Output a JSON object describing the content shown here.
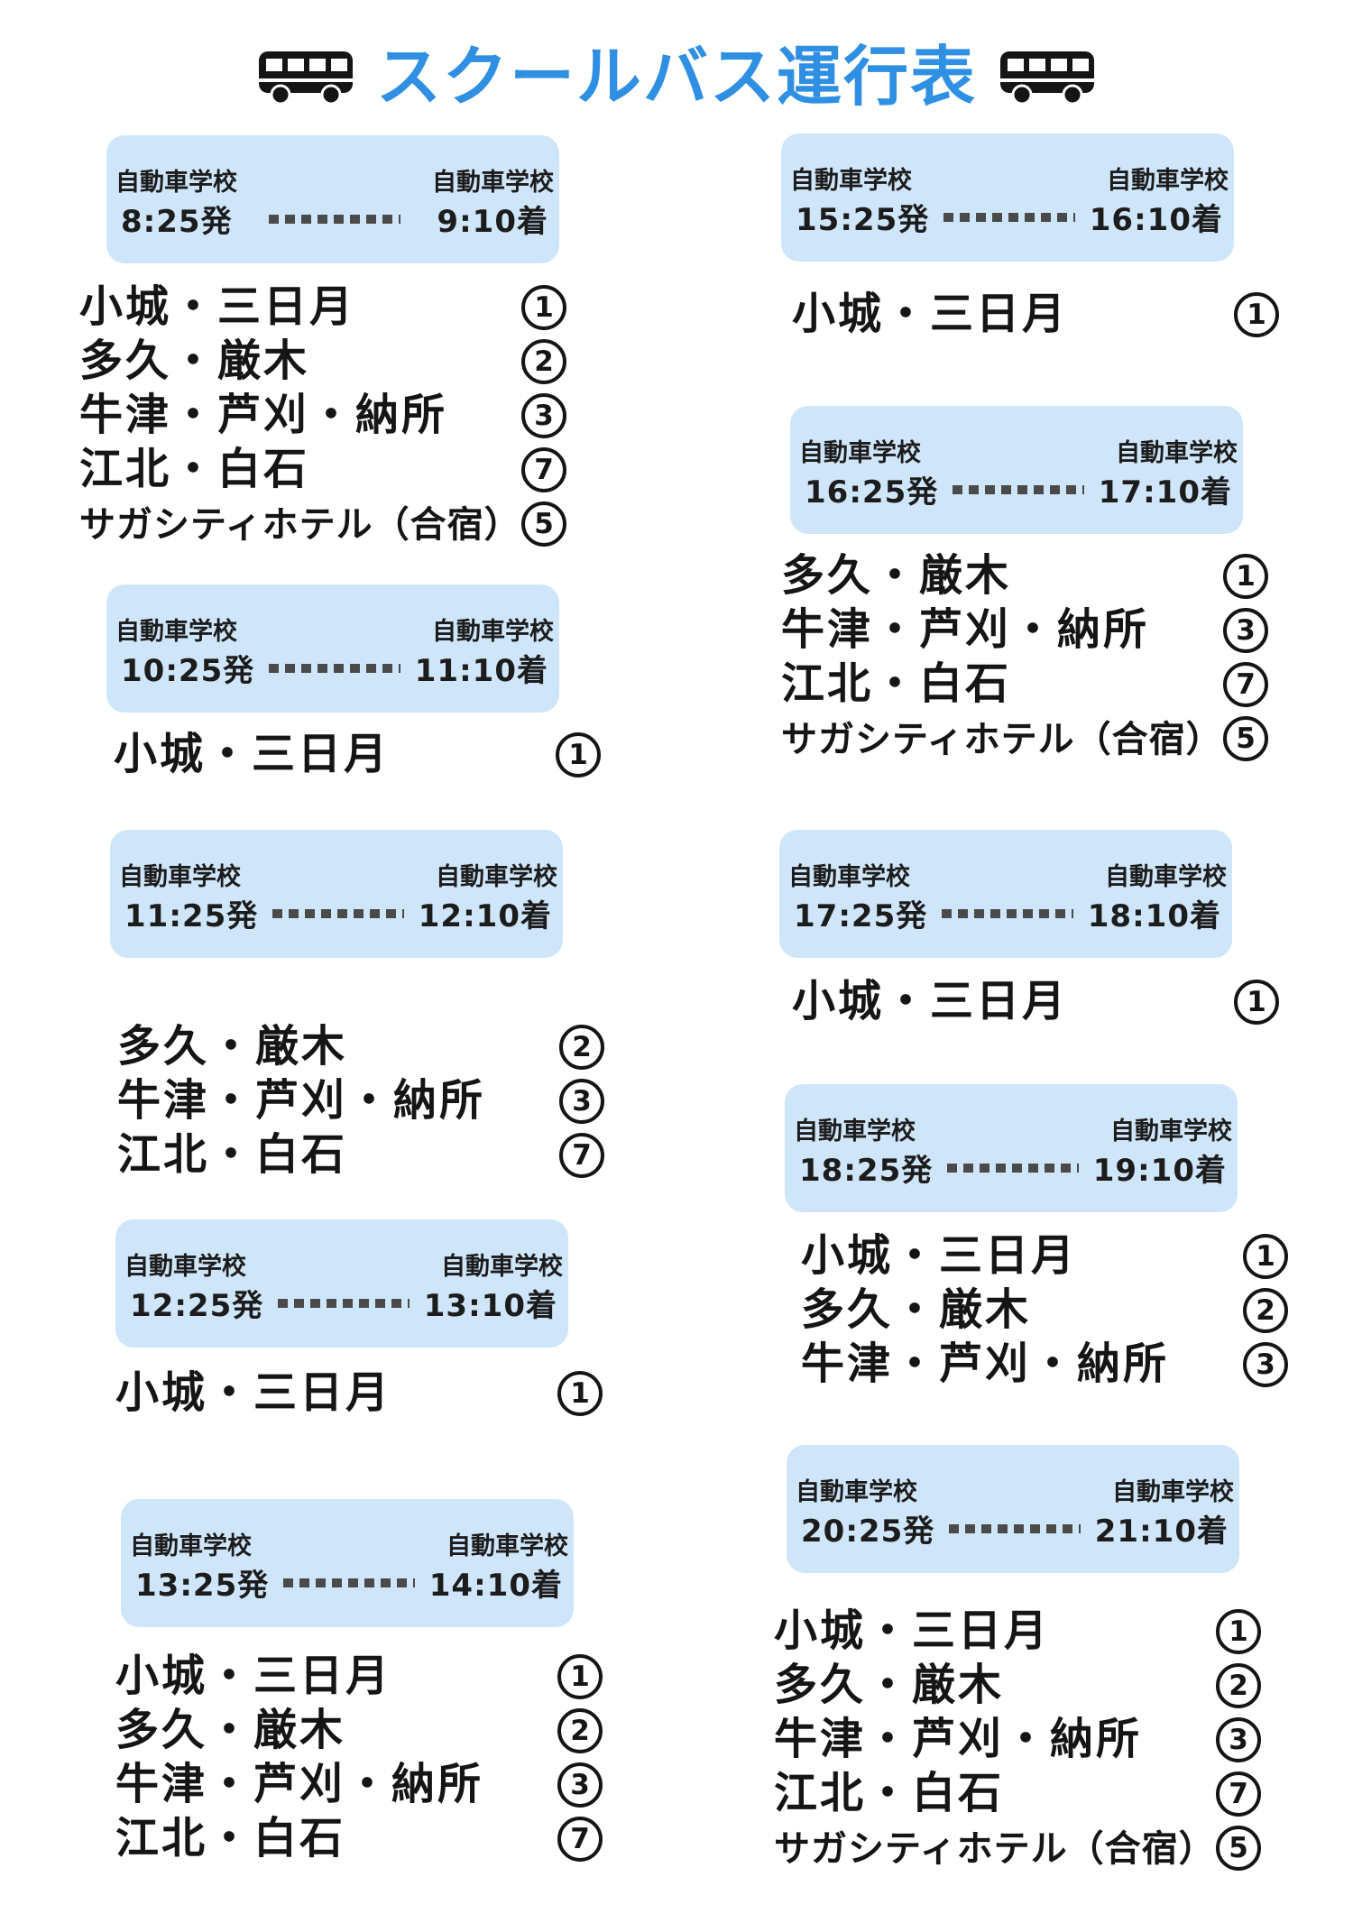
{
  "header": {
    "title": "スクールバス運行表",
    "icon": "bus-icon"
  },
  "schedules": [
    {
      "depart_label": "自動車学校",
      "depart_time": "8:25発",
      "arrive_label": "自動車学校",
      "arrive_time": "9:10着",
      "routes": [
        {
          "name": "小城・三日月",
          "num": "1"
        },
        {
          "name": "多久・厳木",
          "num": "2"
        },
        {
          "name": "牛津・芦刈・納所",
          "num": "3"
        },
        {
          "name": "江北・白石",
          "num": "7"
        },
        {
          "name": "サガシティホテル（合宿）",
          "num": "5"
        }
      ]
    },
    {
      "depart_label": "自動車学校",
      "depart_time": "10:25発",
      "arrive_label": "自動車学校",
      "arrive_time": "11:10着",
      "routes": [
        {
          "name": "小城・三日月",
          "num": "1"
        }
      ]
    },
    {
      "depart_label": "自動車学校",
      "depart_time": "11:25発",
      "arrive_label": "自動車学校",
      "arrive_time": "12:10着",
      "routes": [
        {
          "name": "多久・厳木",
          "num": "2"
        },
        {
          "name": "牛津・芦刈・納所",
          "num": "3"
        },
        {
          "name": "江北・白石",
          "num": "7"
        }
      ]
    },
    {
      "depart_label": "自動車学校",
      "depart_time": "12:25発",
      "arrive_label": "自動車学校",
      "arrive_time": "13:10着",
      "routes": [
        {
          "name": "小城・三日月",
          "num": "1"
        }
      ]
    },
    {
      "depart_label": "自動車学校",
      "depart_time": "13:25発",
      "arrive_label": "自動車学校",
      "arrive_time": "14:10着",
      "routes": [
        {
          "name": "小城・三日月",
          "num": "1"
        },
        {
          "name": "多久・厳木",
          "num": "2"
        },
        {
          "name": "牛津・芦刈・納所",
          "num": "3"
        },
        {
          "name": "江北・白石",
          "num": "7"
        }
      ]
    },
    {
      "depart_label": "自動車学校",
      "depart_time": "15:25発",
      "arrive_label": "自動車学校",
      "arrive_time": "16:10着",
      "routes": [
        {
          "name": "小城・三日月",
          "num": "1"
        }
      ]
    },
    {
      "depart_label": "自動車学校",
      "depart_time": "16:25発",
      "arrive_label": "自動車学校",
      "arrive_time": "17:10着",
      "routes": [
        {
          "name": "多久・厳木",
          "num": "1"
        },
        {
          "name": "牛津・芦刈・納所",
          "num": "3"
        },
        {
          "name": "江北・白石",
          "num": "7"
        },
        {
          "name": "サガシティホテル（合宿）",
          "num": "5"
        }
      ]
    },
    {
      "depart_label": "自動車学校",
      "depart_time": "17:25発",
      "arrive_label": "自動車学校",
      "arrive_time": "18:10着",
      "routes": [
        {
          "name": "小城・三日月",
          "num": "1"
        }
      ]
    },
    {
      "depart_label": "自動車学校",
      "depart_time": "18:25発",
      "arrive_label": "自動車学校",
      "arrive_time": "19:10着",
      "routes": [
        {
          "name": "小城・三日月",
          "num": "1"
        },
        {
          "name": "多久・厳木",
          "num": "2"
        },
        {
          "name": "牛津・芦刈・納所",
          "num": "3"
        }
      ]
    },
    {
      "depart_label": "自動車学校",
      "depart_time": "20:25発",
      "arrive_label": "自動車学校",
      "arrive_time": "21:10着",
      "routes": [
        {
          "name": "小城・三日月",
          "num": "1"
        },
        {
          "name": "多久・厳木",
          "num": "2"
        },
        {
          "name": "牛津・芦刈・納所",
          "num": "3"
        },
        {
          "name": "江北・白石",
          "num": "7"
        },
        {
          "name": "サガシティホテル（合宿）",
          "num": "5"
        }
      ]
    }
  ]
}
